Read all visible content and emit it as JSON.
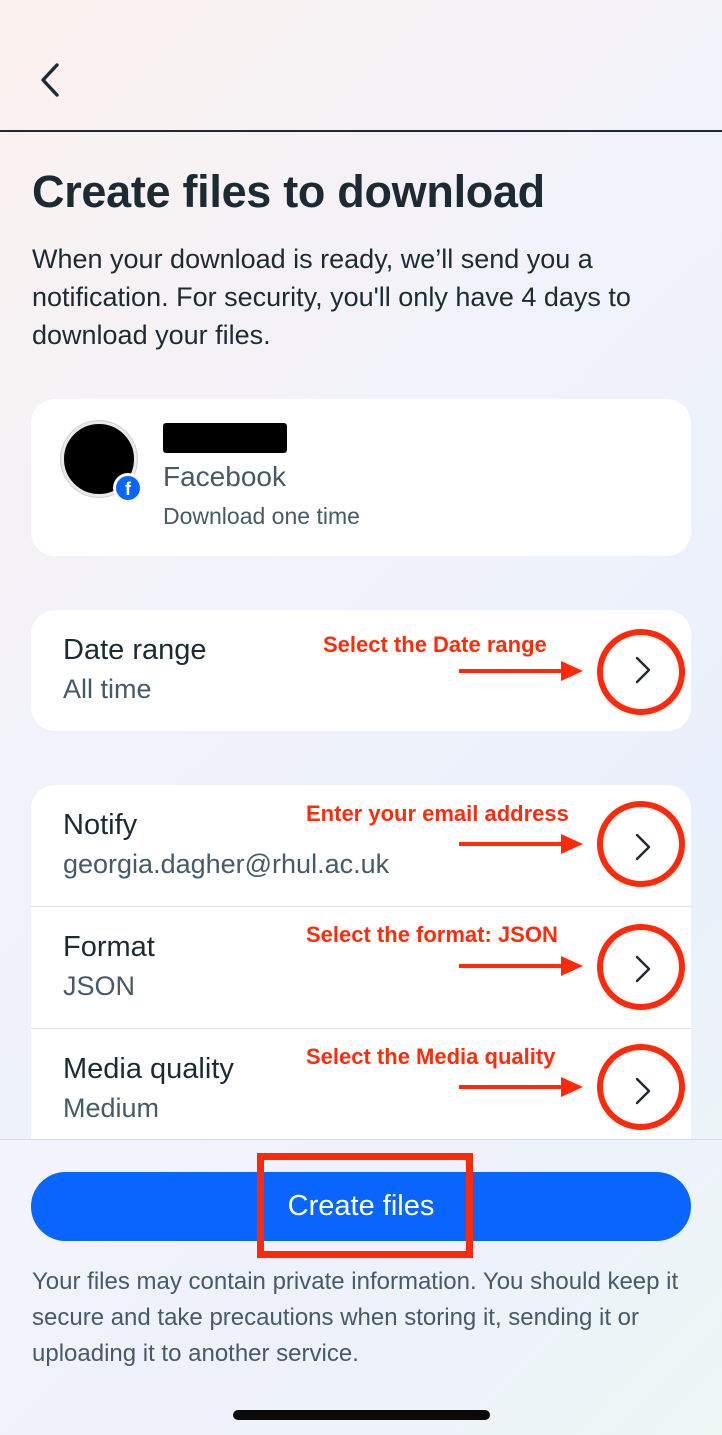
{
  "header": {
    "back_icon": "chevron-left-icon"
  },
  "page": {
    "title": "Create files to download",
    "intro": "When your download is ready, we’ll send you a notification. For security, you'll only have 4 days to download your files."
  },
  "account": {
    "service": "Facebook",
    "note": "Download one time",
    "badge_icon": "facebook-icon",
    "badge_letter": "f"
  },
  "date_range": {
    "label": "Date range",
    "value": "All time"
  },
  "settings": [
    {
      "label": "Notify",
      "value": "georgia.dagher@rhul.ac.uk"
    },
    {
      "label": "Format",
      "value": "JSON"
    },
    {
      "label": "Media quality",
      "value": "Medium"
    }
  ],
  "annotations": {
    "date_range": "Select the Date range",
    "notify": "Enter your email address",
    "format": "Select the format: JSON",
    "media_quality": "Select the Media quality"
  },
  "actions": {
    "create_files_label": "Create files"
  },
  "footer": {
    "disclaimer": "Your files may contain private information. You should keep it secure and take precautions when storing it, sending it or uploading it to another service."
  },
  "colors": {
    "primary_button": "#0866ff",
    "annotation_red": "#ff2a0a",
    "text_primary": "#1c2b33",
    "text_secondary": "#465a69"
  }
}
